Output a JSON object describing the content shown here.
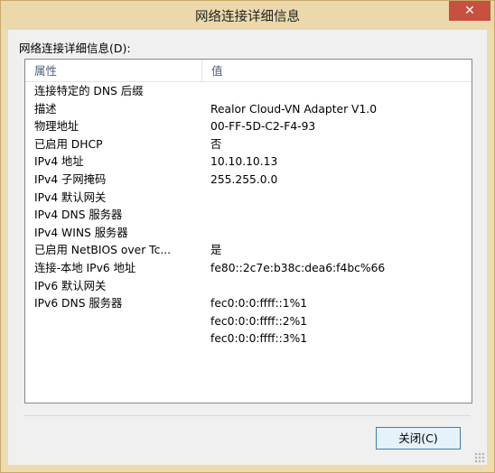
{
  "window": {
    "title": "网络连接详细信息",
    "close_glyph": "✕"
  },
  "section_label": "网络连接详细信息(D):",
  "columns": {
    "attribute": "属性",
    "value": "值"
  },
  "rows": [
    {
      "attr": "连接特定的 DNS 后缀",
      "val": ""
    },
    {
      "attr": "描述",
      "val": "Realor Cloud-VN Adapter V1.0"
    },
    {
      "attr": "物理地址",
      "val": "00-FF-5D-C2-F4-93"
    },
    {
      "attr": "已启用 DHCP",
      "val": "否"
    },
    {
      "attr": "IPv4 地址",
      "val": "10.10.10.13"
    },
    {
      "attr": "IPv4 子网掩码",
      "val": "255.255.0.0"
    },
    {
      "attr": "IPv4 默认网关",
      "val": ""
    },
    {
      "attr": "IPv4 DNS 服务器",
      "val": ""
    },
    {
      "attr": "IPv4 WINS 服务器",
      "val": ""
    },
    {
      "attr": "已启用 NetBIOS over Tc...",
      "val": "是"
    },
    {
      "attr": "连接-本地 IPv6 地址",
      "val": "fe80::2c7e:b38c:dea6:f4bc%66"
    },
    {
      "attr": "IPv6 默认网关",
      "val": ""
    },
    {
      "attr": "IPv6 DNS 服务器",
      "val": "fec0:0:0:ffff::1%1"
    },
    {
      "attr": "",
      "val": "fec0:0:0:ffff::2%1"
    },
    {
      "attr": "",
      "val": "fec0:0:0:ffff::3%1"
    }
  ],
  "buttons": {
    "close": "关闭(C)"
  }
}
